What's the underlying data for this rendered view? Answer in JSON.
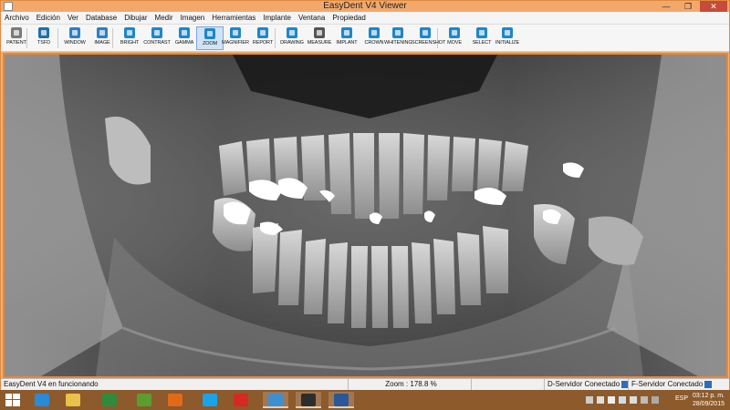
{
  "window": {
    "title": "EasyDent V4 Viewer",
    "minimize": "—",
    "restore": "❐",
    "close": "✕"
  },
  "menu": [
    "Archivo",
    "Edición",
    "Ver",
    "Database",
    "Dibujar",
    "Medir",
    "Imagen",
    "Herramientas",
    "Implante",
    "Ventana",
    "Propiedad"
  ],
  "toolbar": [
    {
      "label": "PATIENT",
      "icon": "patient-icon",
      "color": "#7a7a7a"
    },
    {
      "label": "TSFD",
      "icon": "tsfd-icon",
      "color": "#1d6fa8"
    },
    {
      "label": "WINDOW",
      "icon": "window-icon",
      "color": "#2f7fc3"
    },
    {
      "label": "IMAGE",
      "icon": "image-icon",
      "color": "#2f7fc3"
    },
    {
      "label": "BRIGHT",
      "icon": "brightness-icon",
      "color": "#1f86c9"
    },
    {
      "label": "CONTRAST",
      "icon": "contrast-icon",
      "color": "#1f86c9"
    },
    {
      "label": "GAMMA",
      "icon": "gamma-icon",
      "color": "#1f86c9"
    },
    {
      "label": "ZOOM",
      "icon": "zoom-icon",
      "color": "#1f86c9"
    },
    {
      "label": "MAGNIFIER",
      "icon": "magnifier-icon",
      "color": "#1f86c9"
    },
    {
      "label": "REPORT",
      "icon": "report-icon",
      "color": "#1f86c9"
    },
    {
      "label": "DRAWING",
      "icon": "drawing-icon",
      "color": "#1f86c9"
    },
    {
      "label": "MEASURE",
      "icon": "measure-icon",
      "color": "#555555"
    },
    {
      "label": "IMPLANT",
      "icon": "implant-icon",
      "color": "#1f86c9"
    },
    {
      "label": "CROWN",
      "icon": "crown-icon",
      "color": "#1f86c9"
    },
    {
      "label": "WHITENING",
      "icon": "whitening-icon",
      "color": "#1f86c9"
    },
    {
      "label": "SCREENSHOT",
      "icon": "screenshot-icon",
      "color": "#1f86c9"
    },
    {
      "label": "MOVE",
      "icon": "move-icon",
      "color": "#1f86c9"
    },
    {
      "label": "SELECT",
      "icon": "select-icon",
      "color": "#1f86c9"
    },
    {
      "label": "INITIALIZE",
      "icon": "initialize-icon",
      "color": "#1f86c9"
    }
  ],
  "status": {
    "message": "EasyDent V4 en funcionando",
    "zoom": "Zoom : 178.8 %",
    "server_d": "D-Servidor Conectado",
    "server_f": "F-Servidor Conectado"
  },
  "taskbar": {
    "apps": [
      {
        "name": "internet-explorer",
        "color": "#2a8ad8"
      },
      {
        "name": "file-explorer",
        "color": "#e8c24a"
      },
      {
        "name": "project",
        "color": "#2e8b3d"
      },
      {
        "name": "w-app",
        "color": "#5a9e2f"
      },
      {
        "name": "firefox",
        "color": "#e06a1a"
      },
      {
        "name": "skype",
        "color": "#1aa3e8"
      },
      {
        "name": "acrobat",
        "color": "#d42a1f"
      },
      {
        "name": "viewer",
        "color": "#3d8fd1"
      },
      {
        "name": "easydent",
        "color": "#2d2d2d"
      },
      {
        "name": "word",
        "color": "#2b5797"
      }
    ],
    "language": "ESP",
    "time": "03:12 p. m.",
    "date": "28/09/2015"
  }
}
